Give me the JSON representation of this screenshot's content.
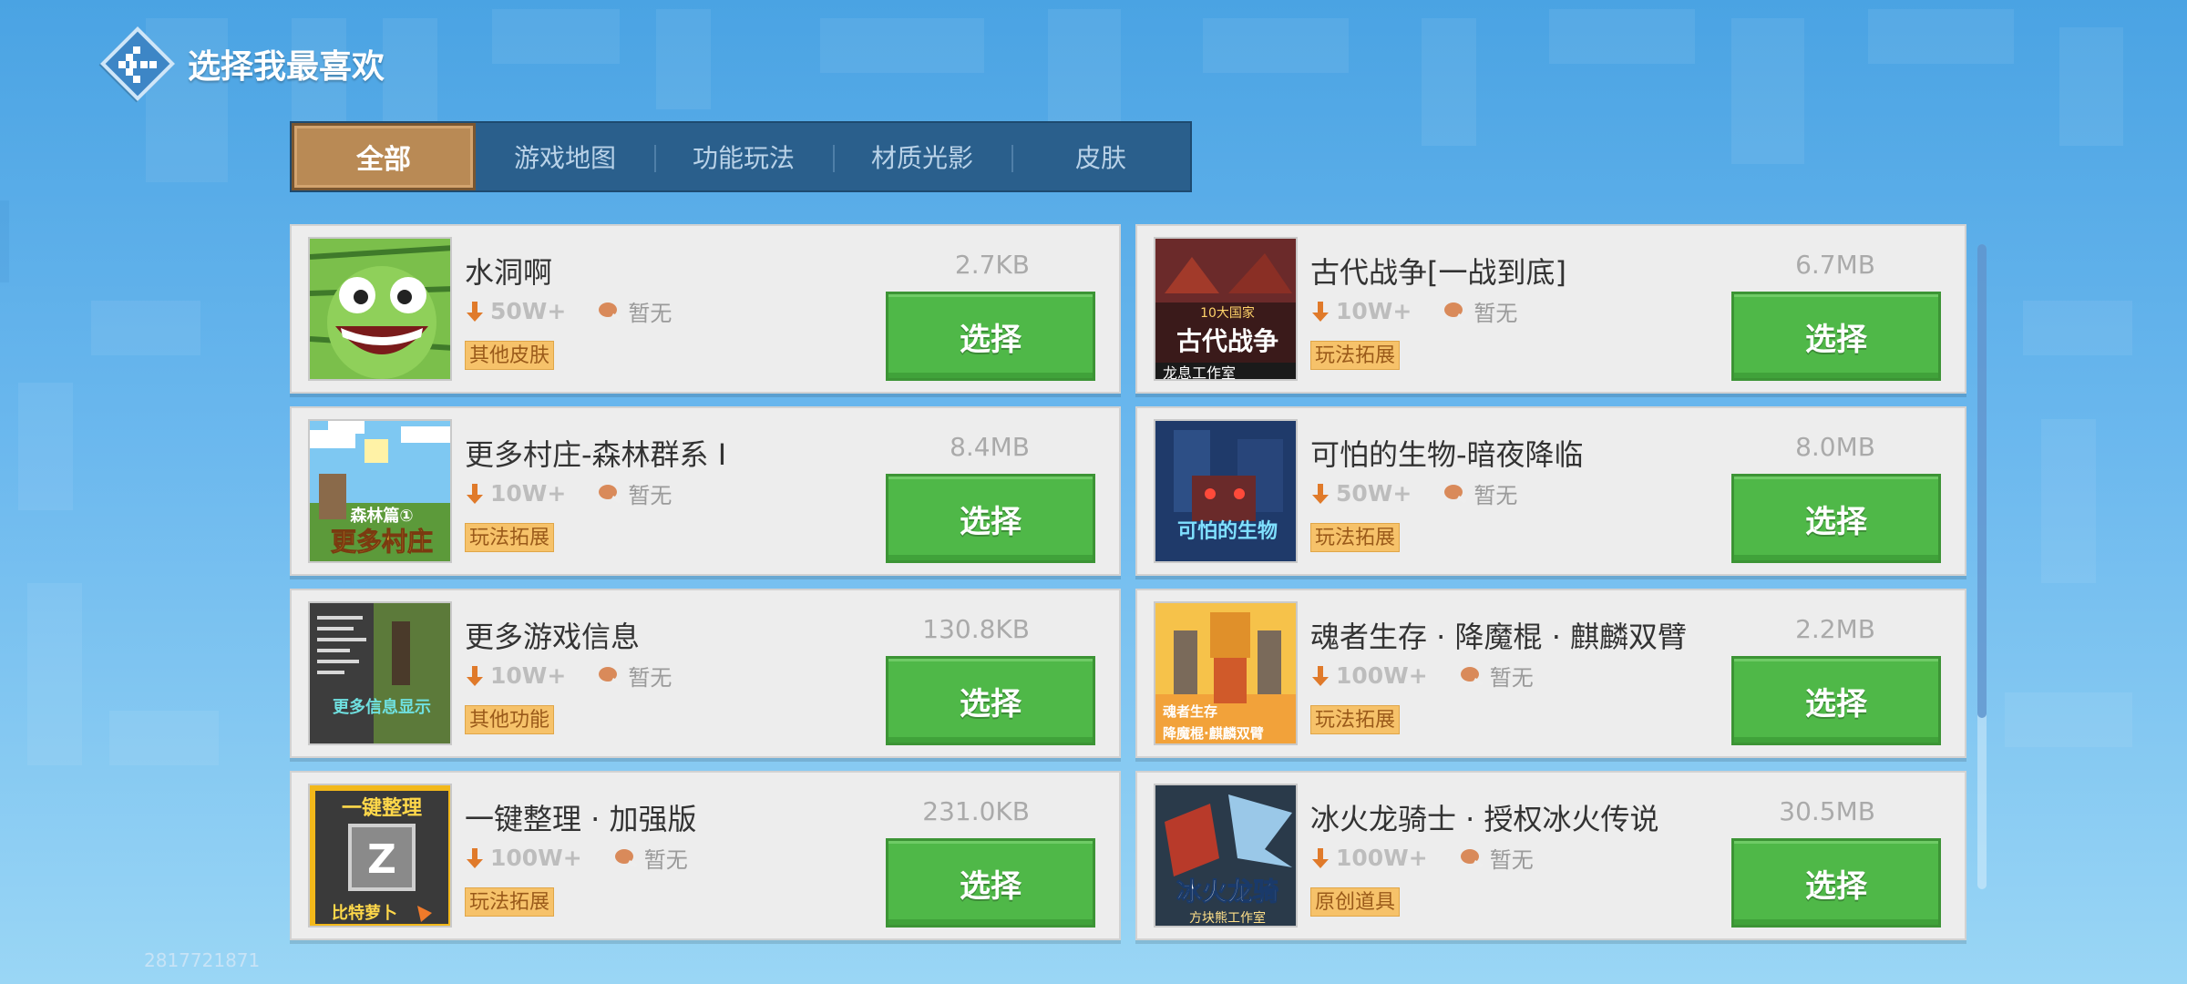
{
  "header": {
    "title": "选择我最喜欢"
  },
  "tabs": [
    {
      "label": "全部",
      "active": true
    },
    {
      "label": "游戏地图",
      "active": false
    },
    {
      "label": "功能玩法",
      "active": false
    },
    {
      "label": "材质光影",
      "active": false
    },
    {
      "label": "皮肤",
      "active": false
    }
  ],
  "items": [
    {
      "title": "水洞啊",
      "downloads": "50W+",
      "rating": "暂无",
      "tag": "其他皮肤",
      "size": "2.7KB",
      "button": "选择",
      "thumb_icon": "watermelon-face"
    },
    {
      "title": "古代战争[一战到底]",
      "downloads": "10W+",
      "rating": "暂无",
      "tag": "玩法拓展",
      "size": "6.7MB",
      "button": "选择",
      "thumb_icon": "ancient-warfare",
      "thumb_text": {
        "top": "10大国家",
        "main": "古代战争",
        "bottom": "龙息工作室"
      }
    },
    {
      "title": "更多村庄-森林群系 I",
      "downloads": "10W+",
      "rating": "暂无",
      "tag": "玩法拓展",
      "size": "8.4MB",
      "button": "选择",
      "thumb_icon": "village",
      "thumb_text": {
        "top": "森林篇①",
        "main": "更多村庄"
      }
    },
    {
      "title": "可怕的生物-暗夜降临",
      "downloads": "50W+",
      "rating": "暂无",
      "tag": "玩法拓展",
      "size": "8.0MB",
      "button": "选择",
      "thumb_icon": "scary-creature",
      "thumb_text": {
        "main": "可怕的生物"
      }
    },
    {
      "title": "更多游戏信息",
      "downloads": "10W+",
      "rating": "暂无",
      "tag": "其他功能",
      "size": "130.8KB",
      "button": "选择",
      "thumb_icon": "game-info",
      "thumb_text": {
        "main": "更多信息显示"
      }
    },
    {
      "title": "魂者生存 · 降魔棍 · 麒麟双臂",
      "downloads": "100W+",
      "rating": "暂无",
      "tag": "玩法拓展",
      "size": "2.2MB",
      "button": "选择",
      "thumb_icon": "monkey-king",
      "thumb_text": {
        "top": "魂者生存",
        "main": "降魔棍·麒麟双臂"
      }
    },
    {
      "title": "一键整理 · 加强版",
      "downloads": "100W+",
      "rating": "暂无",
      "tag": "玩法拓展",
      "size": "231.0KB",
      "button": "选择",
      "thumb_icon": "sort-key",
      "thumb_text": {
        "top": "一键整理",
        "key": "Z",
        "bottom": "比特萝卜"
      }
    },
    {
      "title": "冰火龙骑士 · 授权冰火传说",
      "downloads": "100W+",
      "rating": "暂无",
      "tag": "原创道具",
      "size": "30.5MB",
      "button": "选择",
      "thumb_icon": "dragon-rider",
      "thumb_text": {
        "main": "冰火龙骑",
        "bottom": "方块熊工作室"
      }
    }
  ],
  "footer": {
    "id": "2817721871"
  },
  "colors": {
    "accent_green": "#4fb848",
    "tab_active": "#b98a55",
    "tab_bar": "#2a5f8c",
    "tag_bg": "#f6c26a"
  }
}
